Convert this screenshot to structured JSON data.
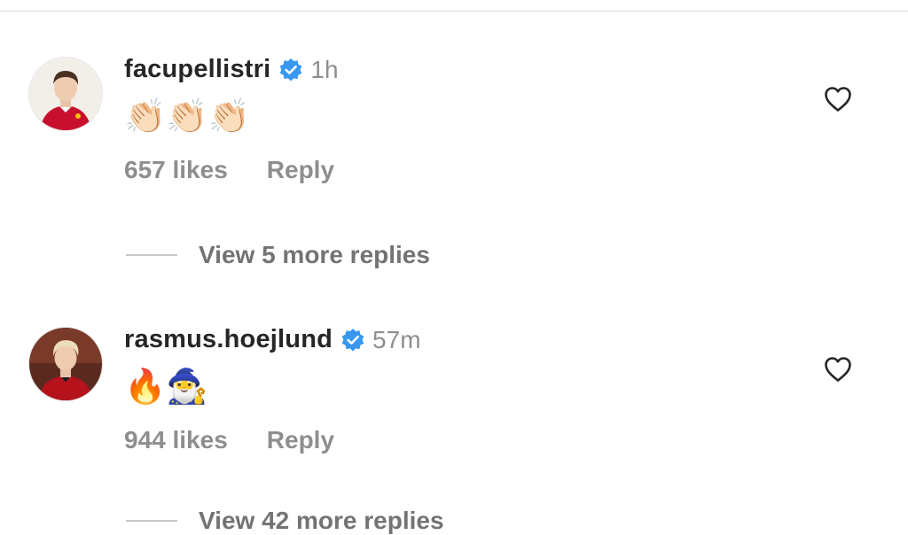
{
  "comments": [
    {
      "username": "facupellistri",
      "verified": true,
      "time": "1h",
      "text": "👏🏻👏🏻👏🏻",
      "likes": "657 likes",
      "reply_label": "Reply",
      "view_replies": "View 5 more replies",
      "avatar_icon": "avatar-photo-red-jersey"
    },
    {
      "username": "rasmus.hoejlund",
      "verified": true,
      "time": "57m",
      "text": "🔥🧙‍♂️",
      "likes": "944 likes",
      "reply_label": "Reply",
      "view_replies": "View 42 more replies",
      "avatar_icon": "avatar-photo-red-jersey"
    }
  ],
  "colors": {
    "verified": "#3897f0",
    "muted_text": "#8e8e8e",
    "primary_text": "#262626"
  }
}
